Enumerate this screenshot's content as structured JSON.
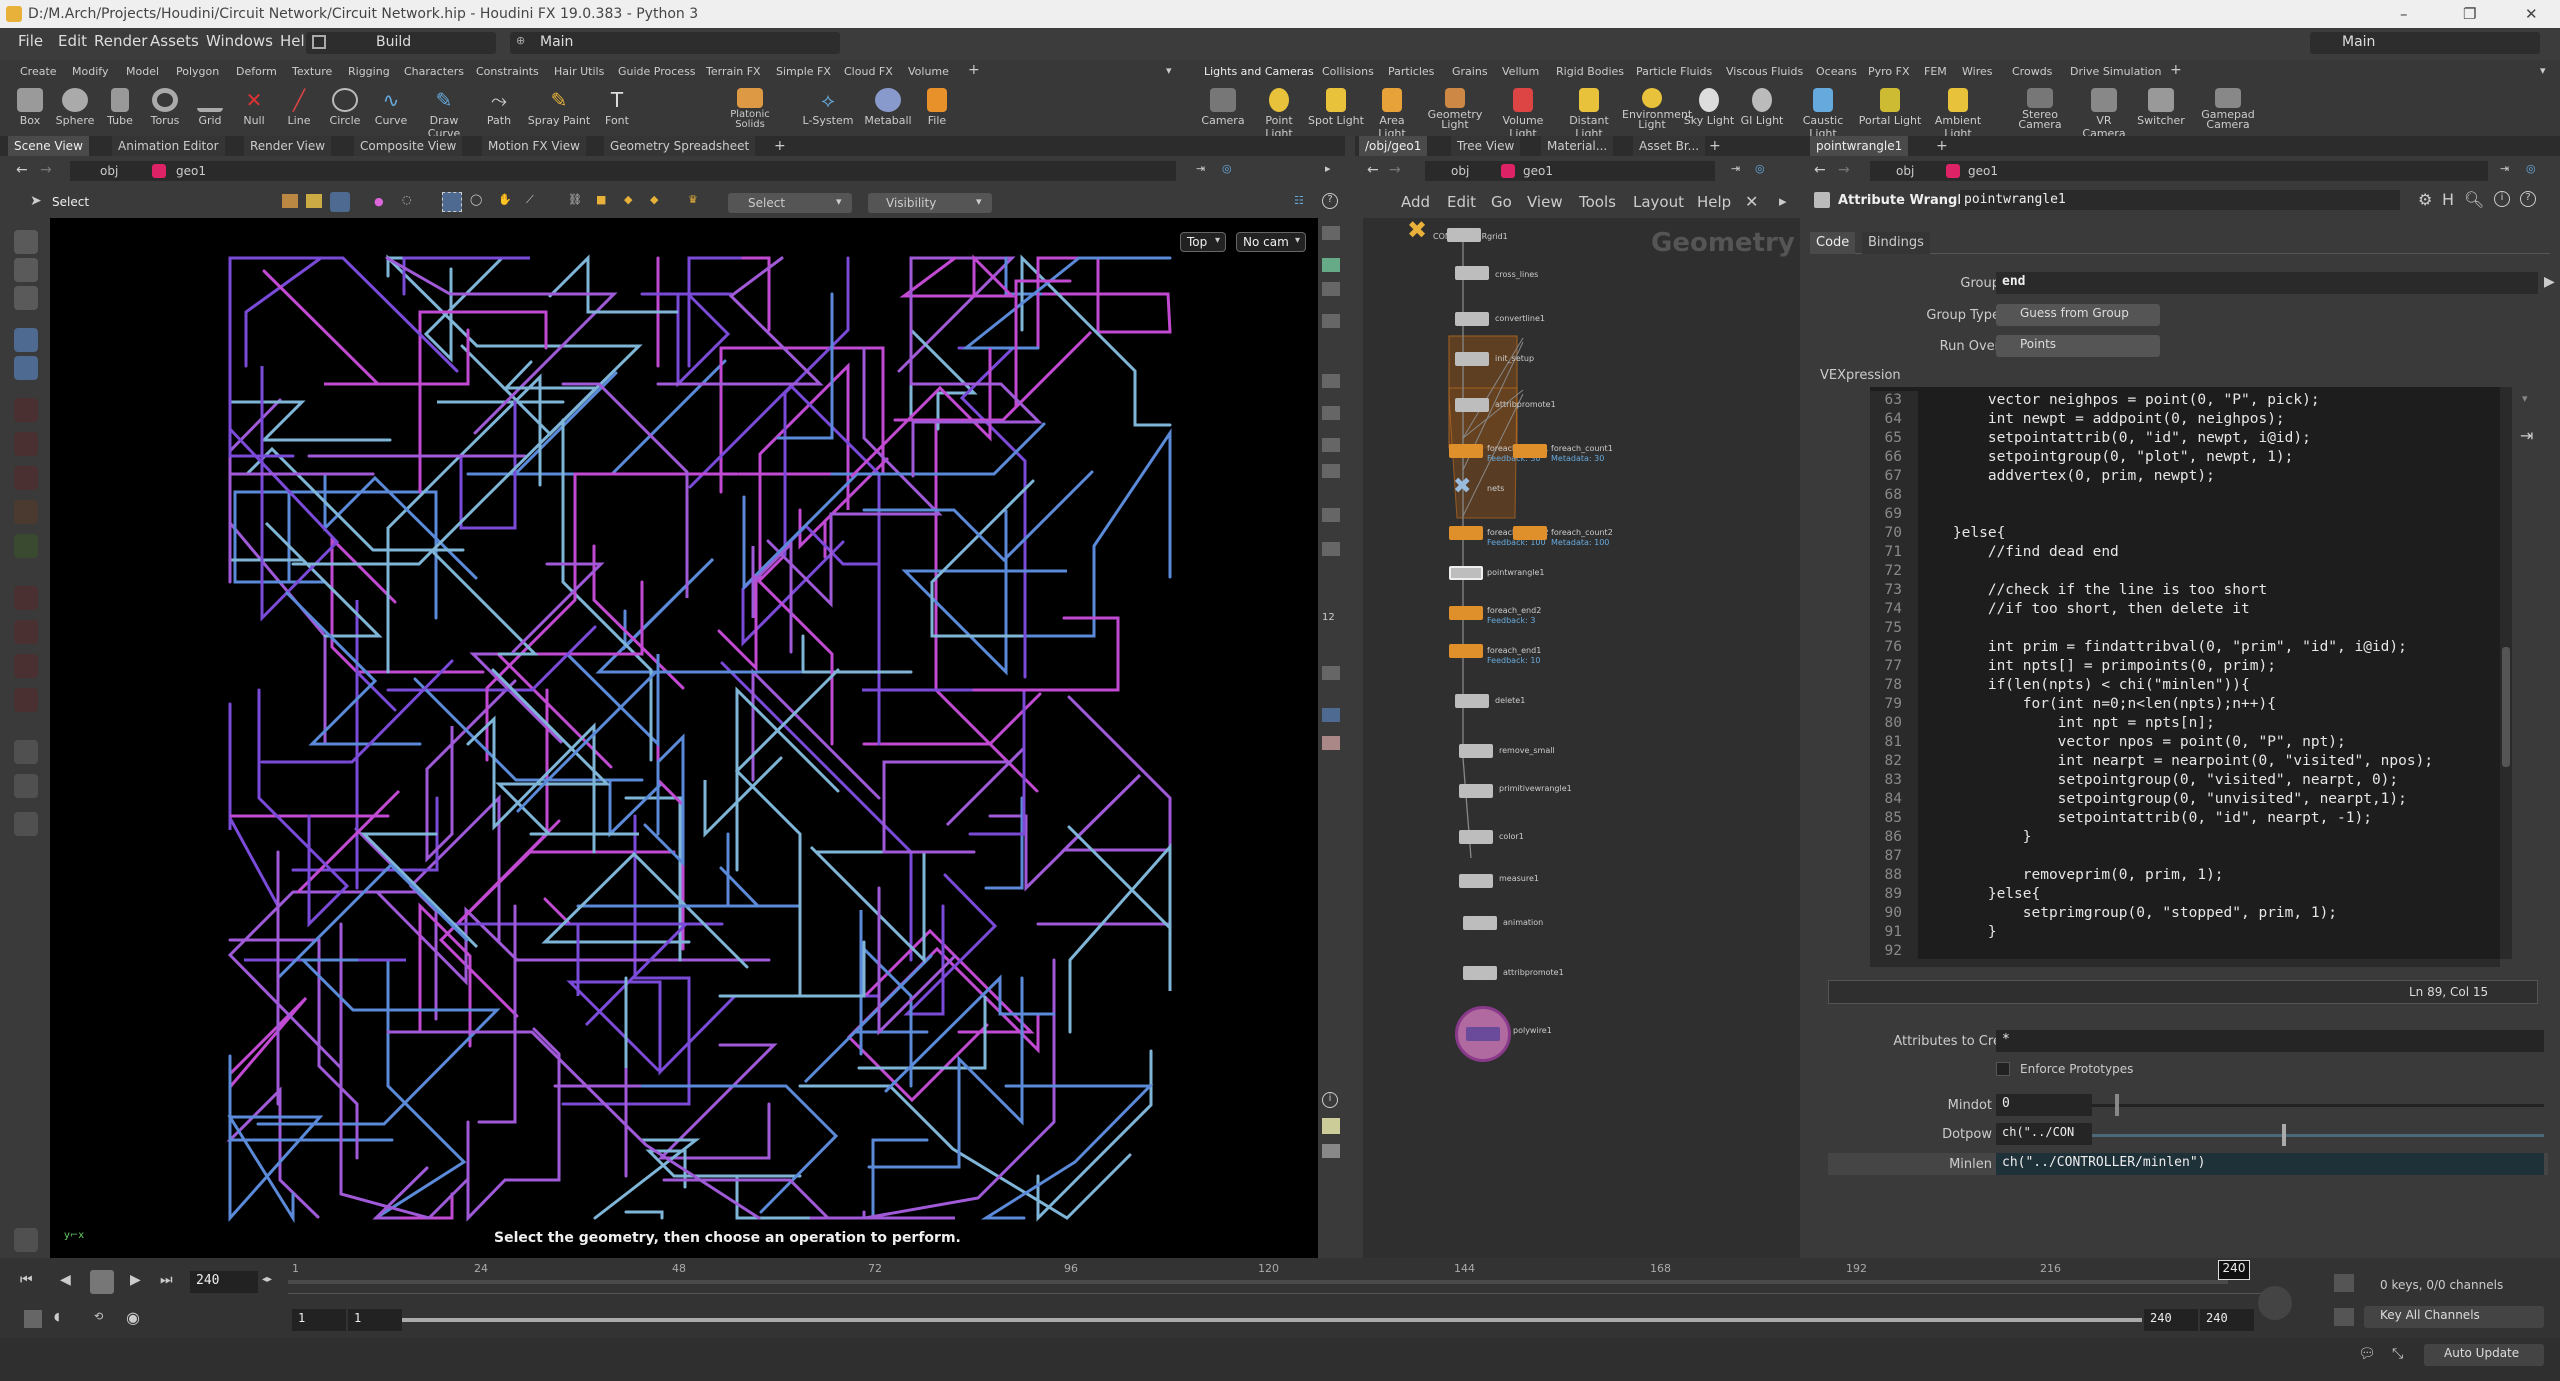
{
  "window": {
    "title": "D:/M.Arch/Projects/Houdini/Circuit Network/Circuit Network.hip - Houdini FX 19.0.383 - Python 3"
  },
  "menu": {
    "items": [
      "File",
      "Edit",
      "Render",
      "Assets",
      "Windows",
      "Help"
    ],
    "desktop": "Build",
    "layout": "Main",
    "right_desktop": "Main"
  },
  "shelf_left": {
    "tabs": [
      "Create",
      "Modify",
      "Model",
      "Polygon",
      "Deform",
      "Texture",
      "Rigging",
      "Characters",
      "Constraints",
      "Hair Utils",
      "Guide Process",
      "Terrain FX",
      "Simple FX",
      "Cloud FX",
      "Volume"
    ],
    "tools": [
      "Box",
      "Sphere",
      "Tube",
      "Torus",
      "Grid",
      "Null",
      "Line",
      "Circle",
      "Curve",
      "Draw Curve",
      "Path",
      "Spray Paint",
      "Font",
      "Platonic Solids",
      "L-System",
      "Metaball",
      "File"
    ]
  },
  "shelf_right": {
    "tabs": [
      "Lights and Cameras",
      "Collisions",
      "Particles",
      "Grains",
      "Vellum",
      "Rigid Bodies",
      "Particle Fluids",
      "Viscous Fluids",
      "Oceans",
      "Pyro FX",
      "FEM",
      "Wires",
      "Crowds",
      "Drive Simulation"
    ],
    "tools": [
      "Camera",
      "Point Light",
      "Spot Light",
      "Area Light",
      "Geometry Light",
      "Volume Light",
      "Distant Light",
      "Environment Light",
      "Sky Light",
      "GI Light",
      "Caustic Light",
      "Portal Light",
      "Ambient Light",
      "Stereo Camera",
      "VR Camera",
      "Switcher",
      "Gamepad Camera"
    ]
  },
  "pane_left": {
    "tabs": [
      "Scene View",
      "Animation Editor",
      "Render View",
      "Composite View",
      "Motion FX View",
      "Geometry Spreadsheet"
    ],
    "path_obj": "obj",
    "path_geo": "geo1",
    "toolbar": {
      "select": "Select",
      "select_mode": "Select",
      "visibility": "Visibility"
    },
    "view": "Top",
    "camera": "No cam",
    "status": "Select the geometry, then choose an operation to perform."
  },
  "pane_mid": {
    "tabs": [
      "/obj/geo1",
      "Tree View",
      "Material...",
      "Asset Br..."
    ],
    "path_obj": "obj",
    "path_geo": "geo1",
    "menu": [
      "Add",
      "Edit",
      "Go",
      "View",
      "Tools",
      "Layout",
      "Help"
    ],
    "context": "Geometry",
    "nodes": [
      "CONTROLLER",
      "grid1",
      "cross_lines",
      "convertline1",
      "init_setup",
      "attribpromote1",
      "foreach_begin1",
      "foreach_count1",
      "nets",
      "foreach_begin2",
      "foreach_count2",
      "pointwrangle1",
      "foreach_end2",
      "foreach_end1",
      "delete1",
      "remove_small",
      "primitivewrangle1",
      "color1",
      "measure1",
      "animation",
      "attribpromote1",
      "polywire1"
    ],
    "sub": {
      "fb1": "Feedback: 30",
      "fc1": "Metadata: 30",
      "fb2": "Feedback: 100",
      "fc2": "Metadata: 100",
      "fe2": "Feedback: 3",
      "fe1": "Feedback: 10"
    }
  },
  "pane_right": {
    "tabs": [
      "pointwrangle1"
    ],
    "path_obj": "obj",
    "path_geo": "geo1",
    "node_type": "Attribute Wrangle",
    "node_name": "pointwrangle1",
    "subtabs": [
      "Code",
      "Bindings"
    ],
    "group_label": "Group",
    "group": "end",
    "group_type_label": "Group Type",
    "group_type": "Guess from Group",
    "run_over_label": "Run Over",
    "run_over": "Points",
    "vex_label": "VEXpression",
    "code": [
      {
        "n": "63",
        "t": "        vector neighpos = point(0, \"P\", pick);"
      },
      {
        "n": "64",
        "t": "        int newpt = addpoint(0, neighpos);"
      },
      {
        "n": "65",
        "t": "        setpointattrib(0, \"id\", newpt, i@id);"
      },
      {
        "n": "66",
        "t": "        setpointgroup(0, \"plot\", newpt, 1);"
      },
      {
        "n": "67",
        "t": "        addvertex(0, prim, newpt);"
      },
      {
        "n": "68",
        "t": ""
      },
      {
        "n": "69",
        "t": ""
      },
      {
        "n": "70",
        "t": "    }else{"
      },
      {
        "n": "71",
        "t": "        //find dead end"
      },
      {
        "n": "72",
        "t": ""
      },
      {
        "n": "73",
        "t": "        //check if the line is too short"
      },
      {
        "n": "74",
        "t": "        //if too short, then delete it"
      },
      {
        "n": "75",
        "t": ""
      },
      {
        "n": "76",
        "t": "        int prim = findattribval(0, \"prim\", \"id\", i@id);"
      },
      {
        "n": "77",
        "t": "        int npts[] = primpoints(0, prim);"
      },
      {
        "n": "78",
        "t": "        if(len(npts) < chi(\"minlen\")){"
      },
      {
        "n": "79",
        "t": "            for(int n=0;n<len(npts);n++){"
      },
      {
        "n": "80",
        "t": "                int npt = npts[n];"
      },
      {
        "n": "81",
        "t": "                vector npos = point(0, \"P\", npt);"
      },
      {
        "n": "82",
        "t": "                int nearpt = nearpoint(0, \"visited\", npos);"
      },
      {
        "n": "83",
        "t": "                setpointgroup(0, \"visited\", nearpt, 0);"
      },
      {
        "n": "84",
        "t": "                setpointgroup(0, \"unvisited\", nearpt,1);"
      },
      {
        "n": "85",
        "t": "                setpointattrib(0, \"id\", nearpt, -1);"
      },
      {
        "n": "86",
        "t": "            }"
      },
      {
        "n": "87",
        "t": ""
      },
      {
        "n": "88",
        "t": "            removeprim(0, prim, 1);"
      },
      {
        "n": "89",
        "t": "        }else{"
      },
      {
        "n": "90",
        "t": "            setprimgroup(0, \"stopped\", prim, 1);"
      },
      {
        "n": "91",
        "t": "        }"
      },
      {
        "n": "92",
        "t": ""
      }
    ],
    "cursor": "Ln 89, Col 15",
    "attrs_label": "Attributes to Create",
    "attrs": "*",
    "enforce": "Enforce Prototypes",
    "mindot_label": "Mindot",
    "mindot": "0",
    "dotpow_label": "Dotpow",
    "dotpow": "ch(\"../CON",
    "minlen_label": "Minlen",
    "minlen": "ch(\"../CONTROLLER/minlen\")",
    "mindot_level": 0.05,
    "dotpow_level": 0.42
  },
  "timeline": {
    "ticks": [
      "1",
      "24",
      "48",
      "72",
      "96",
      "120",
      "144",
      "168",
      "192",
      "216",
      "240"
    ],
    "frame": "240",
    "current": "240",
    "start1": "1",
    "start2": "1",
    "end1": "240",
    "end2": "240",
    "keys": "0 keys, 0/0 channels",
    "key_all": "Key All Channels",
    "auto_update": "Auto Update",
    "progress": 1.0
  },
  "colors": {
    "accent": "#e8b23a",
    "viewport": "#000000",
    "line_cyan": "#7fb6d8",
    "line_magenta": "#c24ad2",
    "line_purple": "#7a4ad8",
    "network_bg": "#2f2f2f",
    "foreach_box": "#c26e1e"
  }
}
